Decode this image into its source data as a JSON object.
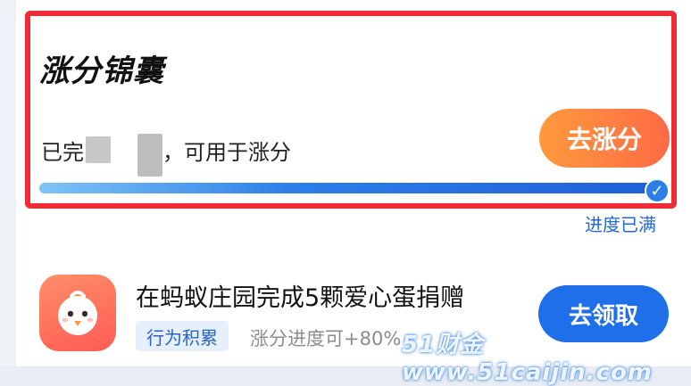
{
  "section": {
    "title": "涨分锦囊",
    "status_prefix": "已完",
    "status_mid": "",
    "status_suffix": "，可用于涨分",
    "rise_button": "去涨分",
    "progress_fraction": 1.0,
    "progress_status": "进度已满"
  },
  "task": {
    "title": "在蚂蚁庄园完成5颗爱心蛋捐赠",
    "tag": "行为积累",
    "desc": "涨分进度可+80%",
    "claim_button": "去领取",
    "icon": "chick-icon"
  },
  "watermark": "51财金www.51caijin.com",
  "colors": {
    "highlight": "#ee2b36",
    "accent_blue": "#1f6fea",
    "accent_orange": "#ff7a40"
  }
}
